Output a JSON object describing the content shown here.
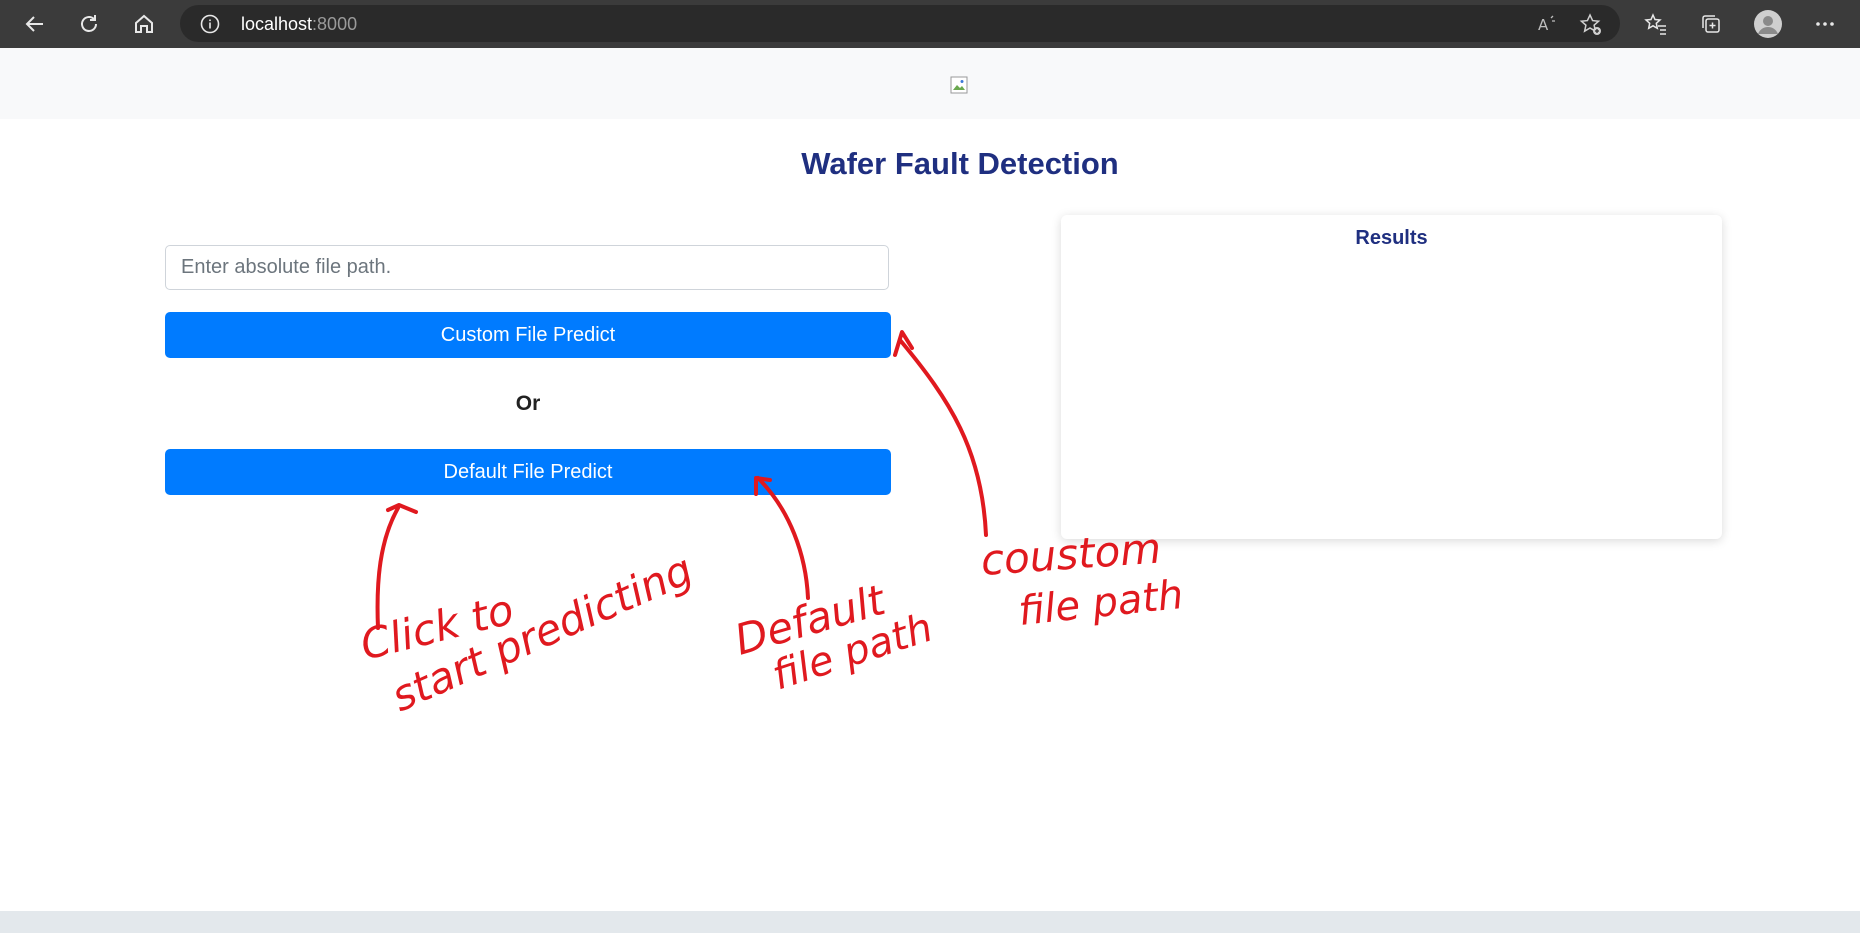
{
  "browser": {
    "url_host": "localhost",
    "url_port": ":8000",
    "icons": [
      "back-icon",
      "refresh-icon",
      "home-icon",
      "info-icon",
      "read-aloud-icon",
      "add-favorite-icon",
      "favorites-icon",
      "collections-icon",
      "profile-icon",
      "more-icon"
    ]
  },
  "page": {
    "title": "Wafer Fault Detection",
    "input_placeholder": "Enter absolute file path.",
    "custom_button": "Custom File Predict",
    "or_label": "Or",
    "default_button": "Default File Predict",
    "results_title": "Results"
  },
  "annotations": {
    "click_line1": "Click to",
    "click_line2": "start predicting",
    "default_line1": "Default",
    "default_line2": "file path",
    "custom_line1": "coustom",
    "custom_line2": "file path",
    "ink_color": "#e0191f"
  },
  "colors": {
    "primary": "#007bff",
    "title": "#1f2f80"
  }
}
